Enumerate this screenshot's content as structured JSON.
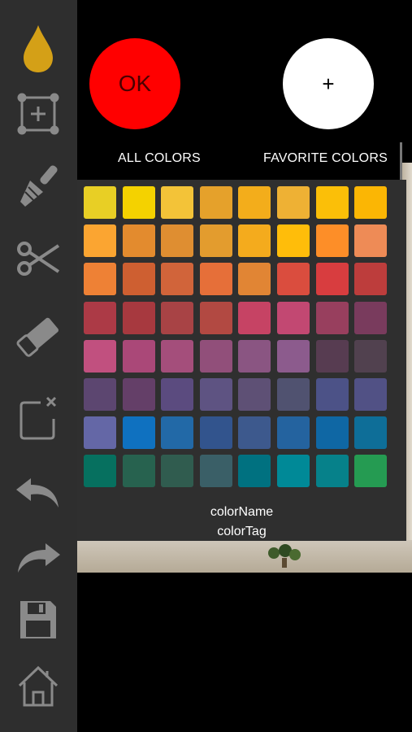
{
  "sidebar": {
    "tools": [
      {
        "name": "color-drop-icon",
        "color": "#d4a017"
      },
      {
        "name": "add-selection-icon"
      },
      {
        "name": "paint-brush-icon"
      },
      {
        "name": "scissors-icon"
      },
      {
        "name": "eraser-icon"
      },
      {
        "name": "clear-selection-icon",
        "glyph": "x"
      },
      {
        "name": "undo-icon"
      },
      {
        "name": "redo-icon"
      },
      {
        "name": "save-icon"
      },
      {
        "name": "home-icon"
      }
    ]
  },
  "actions": {
    "ok_label": "OK",
    "add_label": "+",
    "ok_color": "#ff0000",
    "add_color": "#ffffff"
  },
  "tabs": {
    "all_colors": "ALL COLORS",
    "favorite_colors": "FAVORITE COLORS"
  },
  "palette": {
    "rows": [
      [
        "#e8cf25",
        "#f4d200",
        "#f3c338",
        "#e5a12b",
        "#f3ad1b",
        "#eeb134",
        "#fbbf08",
        "#fbb604"
      ],
      [
        "#fba531",
        "#e38b2e",
        "#df8e31",
        "#e39c2e",
        "#f4ab1d",
        "#ffbd0a",
        "#fd8e28",
        "#ee8b56"
      ],
      [
        "#ee8135",
        "#ce5f31",
        "#d1643a",
        "#e66f39",
        "#e18534",
        "#da4d3e",
        "#d83d3f",
        "#bd3d3c"
      ],
      [
        "#ac3a46",
        "#a7393f",
        "#a84345",
        "#b24942",
        "#c64364",
        "#c24872",
        "#983f5e",
        "#793b5d"
      ],
      [
        "#c1507f",
        "#aa4878",
        "#a44e7b",
        "#914f7a",
        "#8a5582",
        "#8c5b8d",
        "#573c51",
        "#51414f"
      ],
      [
        "#5c4670",
        "#643f68",
        "#5b4b7f",
        "#5e5382",
        "#5e5075",
        "#505270",
        "#4c5287",
        "#515185"
      ],
      [
        "#6467a6",
        "#0f71c0",
        "#2269a7",
        "#32548d",
        "#3d598d",
        "#24639f",
        "#0f67a4",
        "#0e6e98"
      ],
      [
        "#06705f",
        "#27624f",
        "#305c4f",
        "#3a5f67",
        "#007180",
        "#008997",
        "#06818a",
        "#259b52"
      ]
    ],
    "color_name": "colorName",
    "color_tag": "colorTag"
  }
}
